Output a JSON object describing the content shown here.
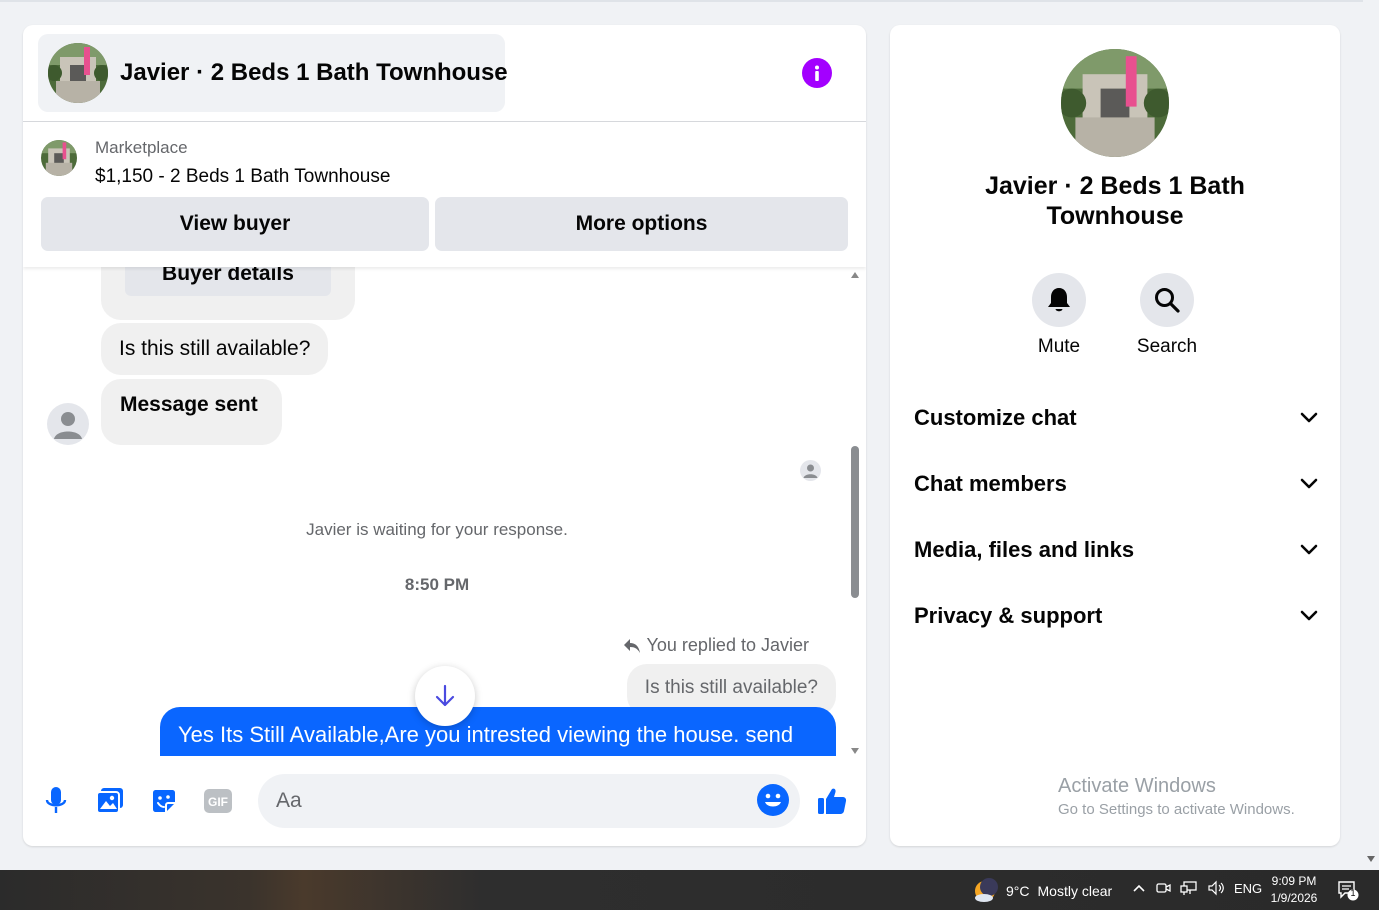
{
  "chat": {
    "title": "Javier · 2 Beds 1 Bath Townhouse",
    "marketplace_label": "Marketplace",
    "listing": "$1,150 - 2 Beds 1 Bath Townhouse",
    "view_buyer": "View buyer",
    "more_options": "More options"
  },
  "messages": {
    "buyer_details": "Buyer details",
    "available": "Is this still available?",
    "message_sent": "Message sent",
    "waiting": "Javier is waiting for your response.",
    "time": "8:50 PM",
    "replied_to": "You replied to Javier",
    "quoted": "Is this still available?",
    "reply_text": "Yes Its Still Available,Are you intrested viewing the house. send"
  },
  "composer": {
    "placeholder": "Aa"
  },
  "info_panel": {
    "name": "Javier · 2 Beds 1 Bath Townhouse",
    "mute": "Mute",
    "search": "Search",
    "menu": [
      "Customize chat",
      "Chat members",
      "Media, files and links",
      "Privacy & support"
    ],
    "watermark_title": "Activate Windows",
    "watermark_sub": "Go to Settings to activate Windows."
  },
  "taskbar": {
    "temperature": "9°C",
    "weather": "Mostly clear",
    "language": "ENG",
    "time": "9:09 PM",
    "date": "1/9/2026",
    "notification_count": "1"
  },
  "colors": {
    "accent_blue": "#0866ff",
    "info_purple": "#a300ff",
    "bubble_grey": "#f0f0f0"
  }
}
